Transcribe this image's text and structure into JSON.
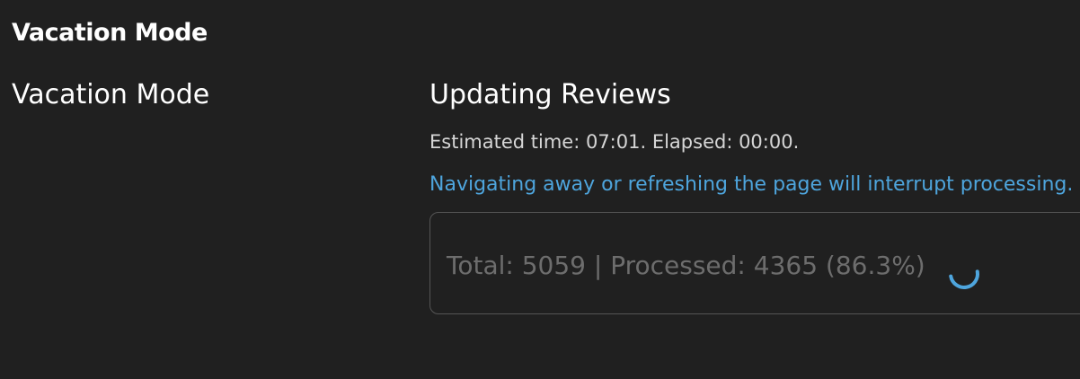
{
  "page": {
    "section_title": "Vacation Mode",
    "row_label": "Vacation Mode"
  },
  "update": {
    "title": "Updating Reviews",
    "estimate_text": "Estimated time: 07:01. Elapsed: 00:00.",
    "warning_text": "Navigating away or refreshing the page will interrupt processing.",
    "progress_text": "Total: 5059 | Processed: 4365 (86.3%)",
    "total": 5059,
    "processed": 4365,
    "percent": 86.3
  },
  "colors": {
    "background": "#202020",
    "warning": "#4ea5dd",
    "spinner": "#4ea5dd"
  },
  "icons": {
    "loading": "spinner-icon"
  }
}
